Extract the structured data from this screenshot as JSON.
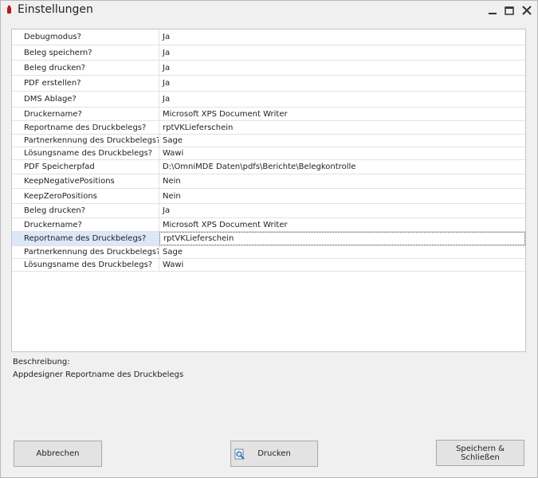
{
  "window": {
    "title": "Einstellungen",
    "icon": "app-icon"
  },
  "properties": [
    {
      "name": "Debugmodus?",
      "value": "Ja"
    },
    {
      "name": "Beleg speichern?",
      "value": "Ja"
    },
    {
      "name": "Beleg drucken?",
      "value": "Ja"
    },
    {
      "name": "PDF erstellen?",
      "value": "Ja"
    },
    {
      "name": "DMS Ablage?",
      "value": "Ja"
    },
    {
      "name": "Druckername?",
      "value": "Microsoft XPS Document Writer"
    },
    {
      "name": "Reportname des Druckbelegs?",
      "value": "rptVKLieferschein"
    },
    {
      "name": "Partnerkennung des Druckbelegs?",
      "value": "Sage"
    },
    {
      "name": "Lösungsname des Druckbelegs?",
      "value": "Wawi"
    },
    {
      "name": "PDF Speicherpfad",
      "value": "D:\\OmniMDE Daten\\pdfs\\Berichte\\Belegkontrolle"
    },
    {
      "name": "KeepNegativePositions",
      "value": "Nein"
    },
    {
      "name": "KeepZeroPositions",
      "value": "Nein"
    },
    {
      "name": "Beleg drucken?",
      "value": "Ja"
    },
    {
      "name": "Druckername?",
      "value": "Microsoft XPS Document Writer"
    },
    {
      "name": "Reportname des Druckbelegs?",
      "value": "rptVKLieferschein"
    },
    {
      "name": "Partnerkennung des Druckbelegs?",
      "value": "Sage"
    },
    {
      "name": "Lösungsname des Druckbelegs?",
      "value": "Wawi"
    }
  ],
  "selected_index": 14,
  "description": {
    "label": "Beschreibung:",
    "text": "Appdesigner Reportname des Druckbelegs"
  },
  "buttons": {
    "cancel": "Abbrechen",
    "print": "Drucken",
    "save": "Speichern & Schließen"
  },
  "colors": {
    "selection": "#dce8f7",
    "accent_icon": "#c01818"
  }
}
